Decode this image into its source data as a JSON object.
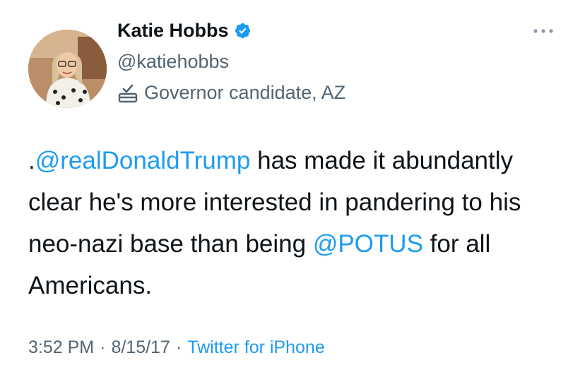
{
  "author": {
    "display_name": "Katie Hobbs",
    "handle": "@katiehobbs",
    "label": "Governor candidate, AZ",
    "verified": true
  },
  "tweet": {
    "prefix": ".",
    "mention_1": "@realDonaldTrump",
    "text_1": " has made it abundantly clear he's more interested in pandering to his neo-nazi base than being ",
    "mention_2": "@POTUS",
    "text_2": " for all Americans."
  },
  "meta": {
    "time": "3:52 PM",
    "separator": "·",
    "date": "8/15/17",
    "source": "Twitter for iPhone"
  },
  "colors": {
    "accent": "#1d9bf0",
    "text": "#0f1419",
    "secondary": "#536471"
  },
  "icons": {
    "verified": "verified-badge-icon",
    "label": "ballot-box-icon",
    "more": "more-options-icon"
  }
}
